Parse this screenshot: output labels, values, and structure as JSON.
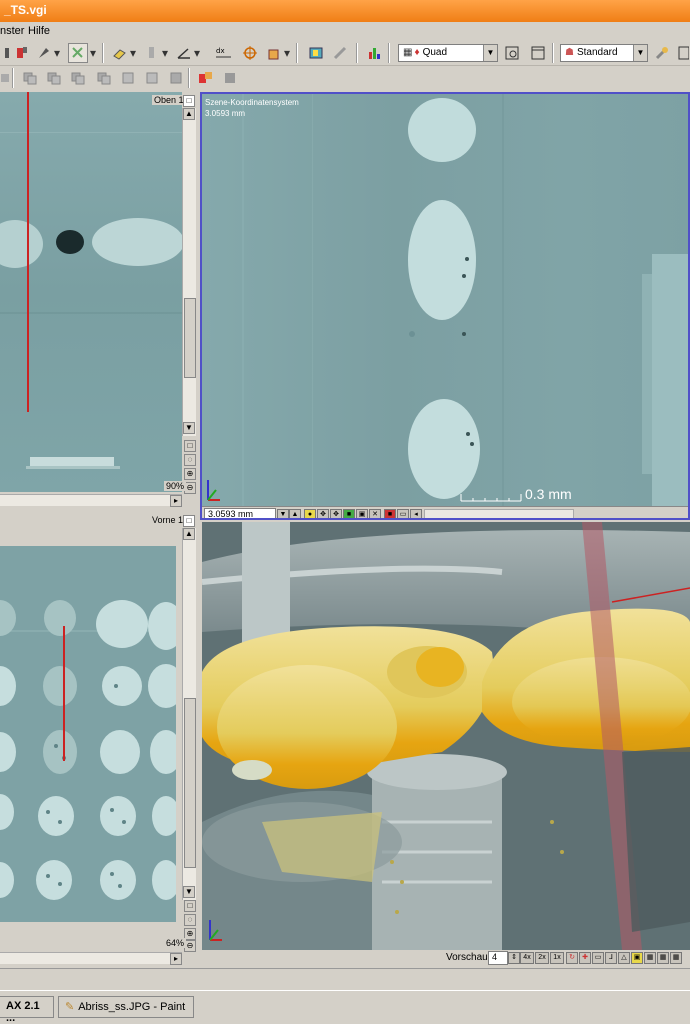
{
  "window": {
    "title": "_TS.vgi"
  },
  "menu": {
    "items": [
      "nster",
      "Hilfe"
    ]
  },
  "toolbar": {
    "layout_combo": "Quad",
    "view_combo": "Standard"
  },
  "viewports": {
    "top_left": {
      "label": "Oben 1",
      "zoom": "90%"
    },
    "top_right": {
      "label": "Szene-Koordinatensystem",
      "value": "3.0593 mm",
      "scale_text": "0.3 mm",
      "field_value": "3.0593 mm"
    },
    "bottom_left": {
      "label": "Vorne 1",
      "zoom": "64%"
    },
    "bottom_right": {
      "preview_label": "Vorschau:",
      "preview_value": "4",
      "preview_buttons": [
        "4x",
        "2x",
        "1x"
      ]
    }
  },
  "taskbar": {
    "items": [
      "AX 2.1 ...",
      "Abriss_ss.JPG - Paint"
    ]
  },
  "colors": {
    "ct_slice": "#7fa3a5",
    "title_orange": "#f07e15",
    "active_border": "#5050c8",
    "voxel_gold": "#e8c54a"
  }
}
